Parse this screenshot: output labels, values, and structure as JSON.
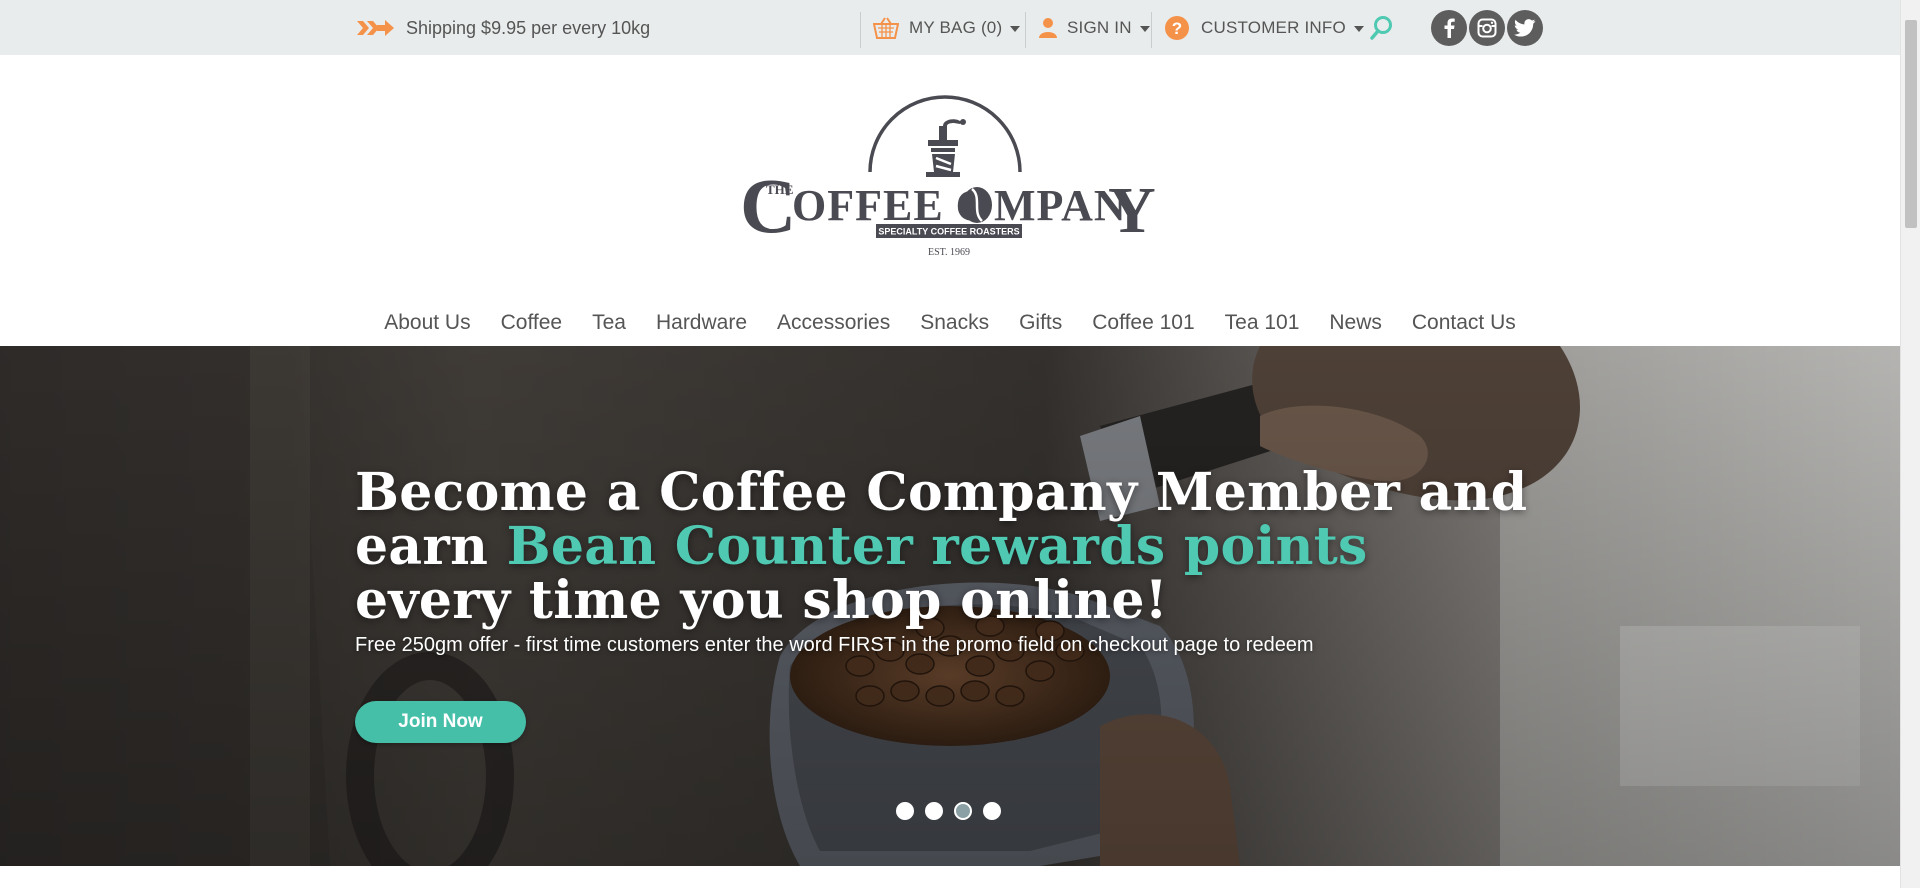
{
  "topbar": {
    "shipping_text": "Shipping $9.95 per every 10kg",
    "bag_label": "MY BAG (0)",
    "signin_label": "SIGN IN",
    "customer_info_label": "CUSTOMER INFO",
    "icons": [
      "arrow-icon",
      "basket-icon",
      "user-icon",
      "help-icon",
      "search-icon",
      "facebook-icon",
      "instagram-icon",
      "twitter-icon"
    ],
    "accent_color": "#f5924a",
    "search_color": "#4fc9b2"
  },
  "logo": {
    "the": "THE",
    "name_part1": "C",
    "name_part2": "OFFEE C",
    "name_part3": "MPAN",
    "name_part4": "Y",
    "tagline": "SPECIALTY COFFEE ROASTERS",
    "est": "EST. 1969"
  },
  "nav": {
    "items": [
      "About Us",
      "Coffee",
      "Tea",
      "Hardware",
      "Accessories",
      "Snacks",
      "Gifts",
      "Coffee 101",
      "Tea 101",
      "News",
      "Contact Us"
    ]
  },
  "hero": {
    "line1": "Become a Coffee Company Member and",
    "line2_prefix": "earn ",
    "line2_accent": "Bean Counter rewards points",
    "line3": "every time you shop online!",
    "subtext": "Free 250gm offer - first time customers enter the word FIRST in the promo field on checkout page to redeem",
    "button_label": "Join Now",
    "accent_color": "#4fc9b2",
    "button_color": "#46bfa8",
    "slides_total": 4,
    "active_slide": 3
  }
}
